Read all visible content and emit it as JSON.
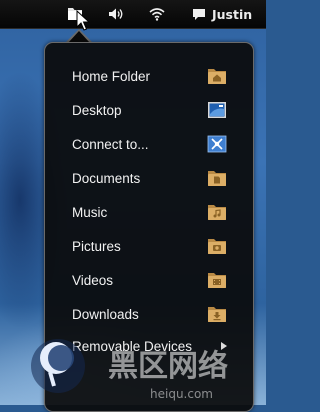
{
  "top_bar": {
    "places_icon": "folder-icon",
    "volume_icon": "speaker-icon",
    "network_icon": "wifi-icon",
    "user_icon": "chat-bubble-icon",
    "user_name": "Justin"
  },
  "places_menu": {
    "items": [
      {
        "label": "Home Folder",
        "icon": "home-folder-icon"
      },
      {
        "label": "Desktop",
        "icon": "desktop-icon"
      },
      {
        "label": "Connect to...",
        "icon": "connect-server-icon"
      },
      {
        "label": "Documents",
        "icon": "documents-folder-icon"
      },
      {
        "label": "Music",
        "icon": "music-folder-icon"
      },
      {
        "label": "Pictures",
        "icon": "pictures-folder-icon"
      },
      {
        "label": "Videos",
        "icon": "videos-folder-icon"
      },
      {
        "label": "Downloads",
        "icon": "downloads-folder-icon"
      }
    ],
    "removable_devices_label": "Removable Devices"
  },
  "watermark": {
    "text": "黑区网络",
    "url": "heiqu.com"
  },
  "colors": {
    "folder": "#d9a960",
    "menu_bg": "#0a0a0a",
    "top_bar": "#0a0a0a",
    "desktop": "#2f62a0"
  }
}
